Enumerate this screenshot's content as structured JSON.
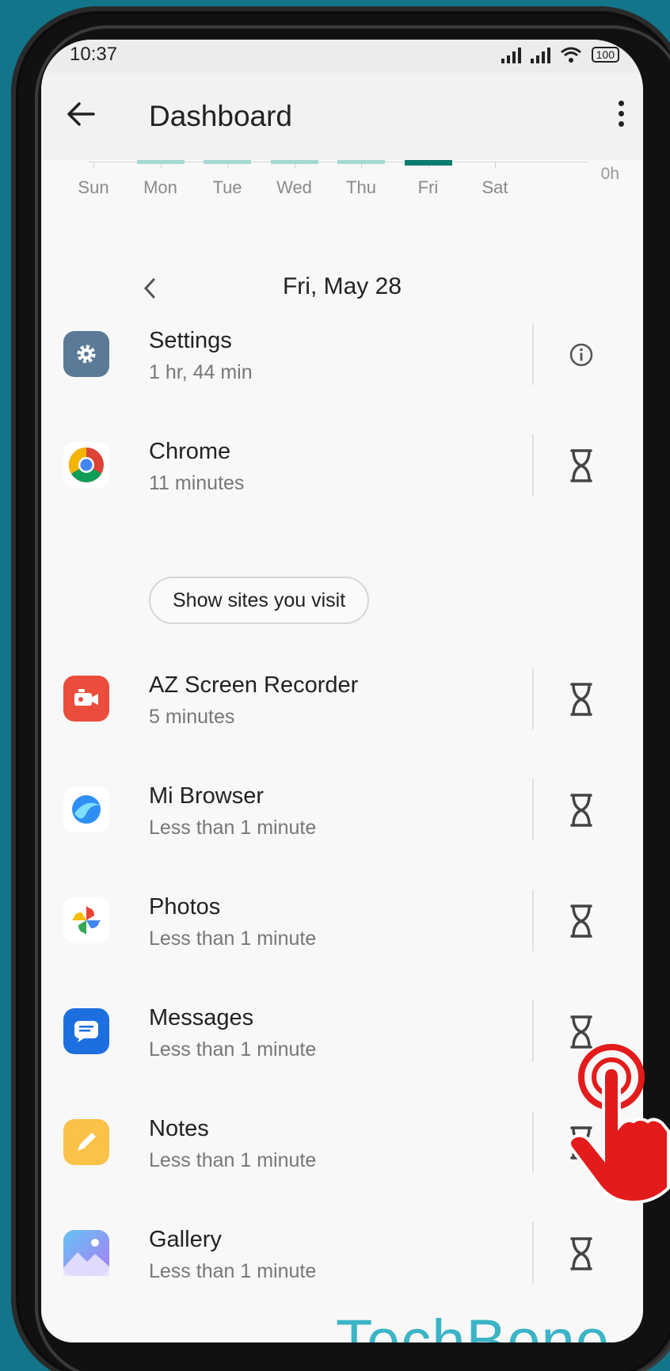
{
  "status": {
    "time": "10:37",
    "battery": "100"
  },
  "appbar": {
    "title": "Dashboard"
  },
  "chart": {
    "axis_label": "0h",
    "days": [
      {
        "label": "Sun",
        "usage": 0
      },
      {
        "label": "Mon",
        "usage": 0.3
      },
      {
        "label": "Tue",
        "usage": 0.3
      },
      {
        "label": "Wed",
        "usage": 0.3
      },
      {
        "label": "Thu",
        "usage": 0.3
      },
      {
        "label": "Fri",
        "usage": 1,
        "selected": true
      },
      {
        "label": "Sat",
        "usage": 0
      }
    ],
    "colors": {
      "bar": "#a6d8d2",
      "selected": "#0e7d6f"
    }
  },
  "date_nav": {
    "label": "Fri, May 28"
  },
  "apps": [
    {
      "name": "Settings",
      "time": "1 hr, 44 min",
      "icon": "settings-icon",
      "action": "info-icon",
      "color": "#5a7a96"
    },
    {
      "name": "Chrome",
      "time": "11 minutes",
      "icon": "chrome-icon",
      "action": "hourglass-icon",
      "color": "#ffffff"
    },
    {
      "name": "AZ Screen Recorder",
      "time": "5 minutes",
      "icon": "az-recorder-icon",
      "action": "hourglass-icon",
      "color": "#ea4d3c"
    },
    {
      "name": "Mi Browser",
      "time": "Less than 1 minute",
      "icon": "mi-browser-icon",
      "action": "hourglass-icon",
      "color": "#ffffff"
    },
    {
      "name": "Photos",
      "time": "Less than 1 minute",
      "icon": "photos-icon",
      "action": "hourglass-icon",
      "color": "#ffffff"
    },
    {
      "name": "Messages",
      "time": "Less than 1 minute",
      "icon": "messages-icon",
      "action": "hourglass-icon",
      "color": "#1d6fe0"
    },
    {
      "name": "Notes",
      "time": "Less than 1 minute",
      "icon": "notes-icon",
      "action": "hourglass-icon",
      "color": "#fbc24a"
    },
    {
      "name": "Gallery",
      "time": "Less than 1 minute",
      "icon": "gallery-icon",
      "action": "hourglass-icon",
      "color": "#8a7cf0"
    }
  ],
  "sites_button": {
    "label": "Show sites you visit"
  },
  "watermark": "TechBone"
}
